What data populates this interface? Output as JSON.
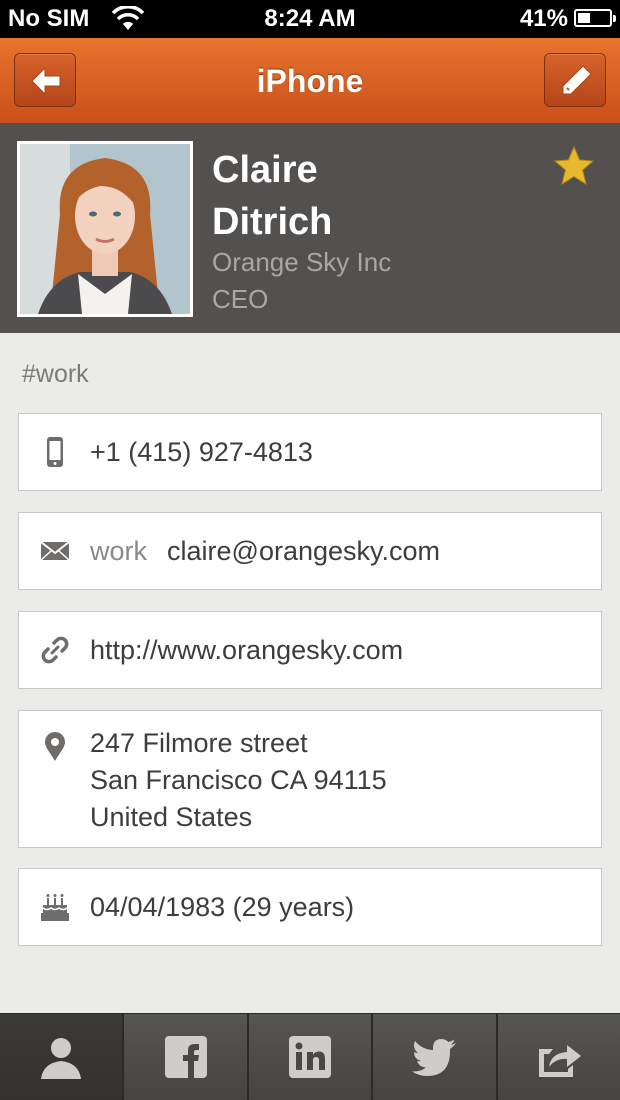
{
  "status_bar": {
    "carrier": "No SIM",
    "time": "8:24 AM",
    "battery_percent": "41%",
    "battery_level": 0.41
  },
  "nav": {
    "title": "iPhone",
    "back_icon": "back-arrow-icon",
    "edit_icon": "pencil-icon"
  },
  "contact": {
    "first_name": "Claire",
    "last_name": "Ditrich",
    "company": "Orange Sky Inc",
    "role": "CEO",
    "favorite": true
  },
  "tag": "#work",
  "details": {
    "phone": "+1 (415) 927-4813",
    "email_label": "work",
    "email": "claire@orangesky.com",
    "website": "http://www.orangesky.com",
    "address_line1": "247 Filmore street",
    "address_line2": "San Francisco CA 94115",
    "address_line3": "United States",
    "birthday": "04/04/1983 (29 years)"
  },
  "tabs": [
    {
      "icon": "person-icon",
      "active": true
    },
    {
      "icon": "facebook-icon",
      "active": false
    },
    {
      "icon": "linkedin-icon",
      "active": false
    },
    {
      "icon": "twitter-icon",
      "active": false
    },
    {
      "icon": "share-icon",
      "active": false
    }
  ],
  "colors": {
    "nav_orange": "#d9622a",
    "header_gray": "#535150",
    "background": "#ebebea",
    "star_gold": "#e8b92c"
  }
}
